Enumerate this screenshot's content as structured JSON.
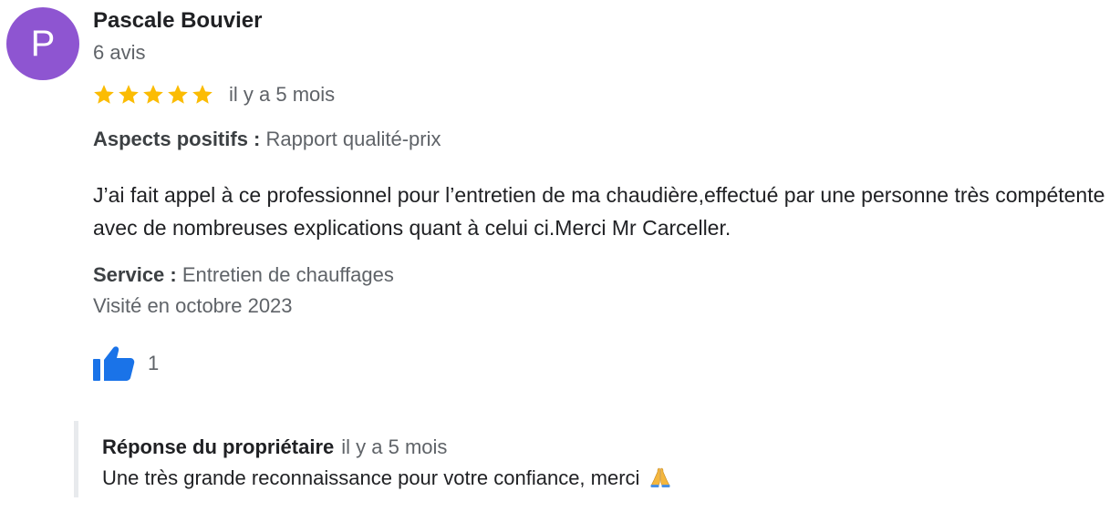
{
  "reviewer": {
    "initial": "P",
    "name": "Pascale Bouvier",
    "review_count": "6 avis",
    "avatar_color": "#8e55d1"
  },
  "rating": {
    "stars": 5,
    "max": 5,
    "star_color": "#fbbc04",
    "date": "il y a 5 mois"
  },
  "aspects": {
    "label": "Aspects positifs :",
    "value": "Rapport qualité-prix"
  },
  "review_text": "J’ai fait appel à ce professionnel pour l’entretien de ma chaudière,effectué par une personne très compétente avec de nombreuses explications quant à celui ci.Merci Mr Carceller.",
  "service": {
    "label": "Service :",
    "value": "Entretien de chauffages"
  },
  "visit": "Visité en octobre 2023",
  "likes": {
    "icon": "thumbs-up-icon",
    "count": "1",
    "color": "#1a73e8"
  },
  "owner_reply": {
    "title": "Réponse du propriétaire",
    "date": "il y a 5 mois",
    "text": "Une très grande reconnaissance pour votre confiance, merci",
    "emoji_icon": "folded-hands-icon"
  }
}
